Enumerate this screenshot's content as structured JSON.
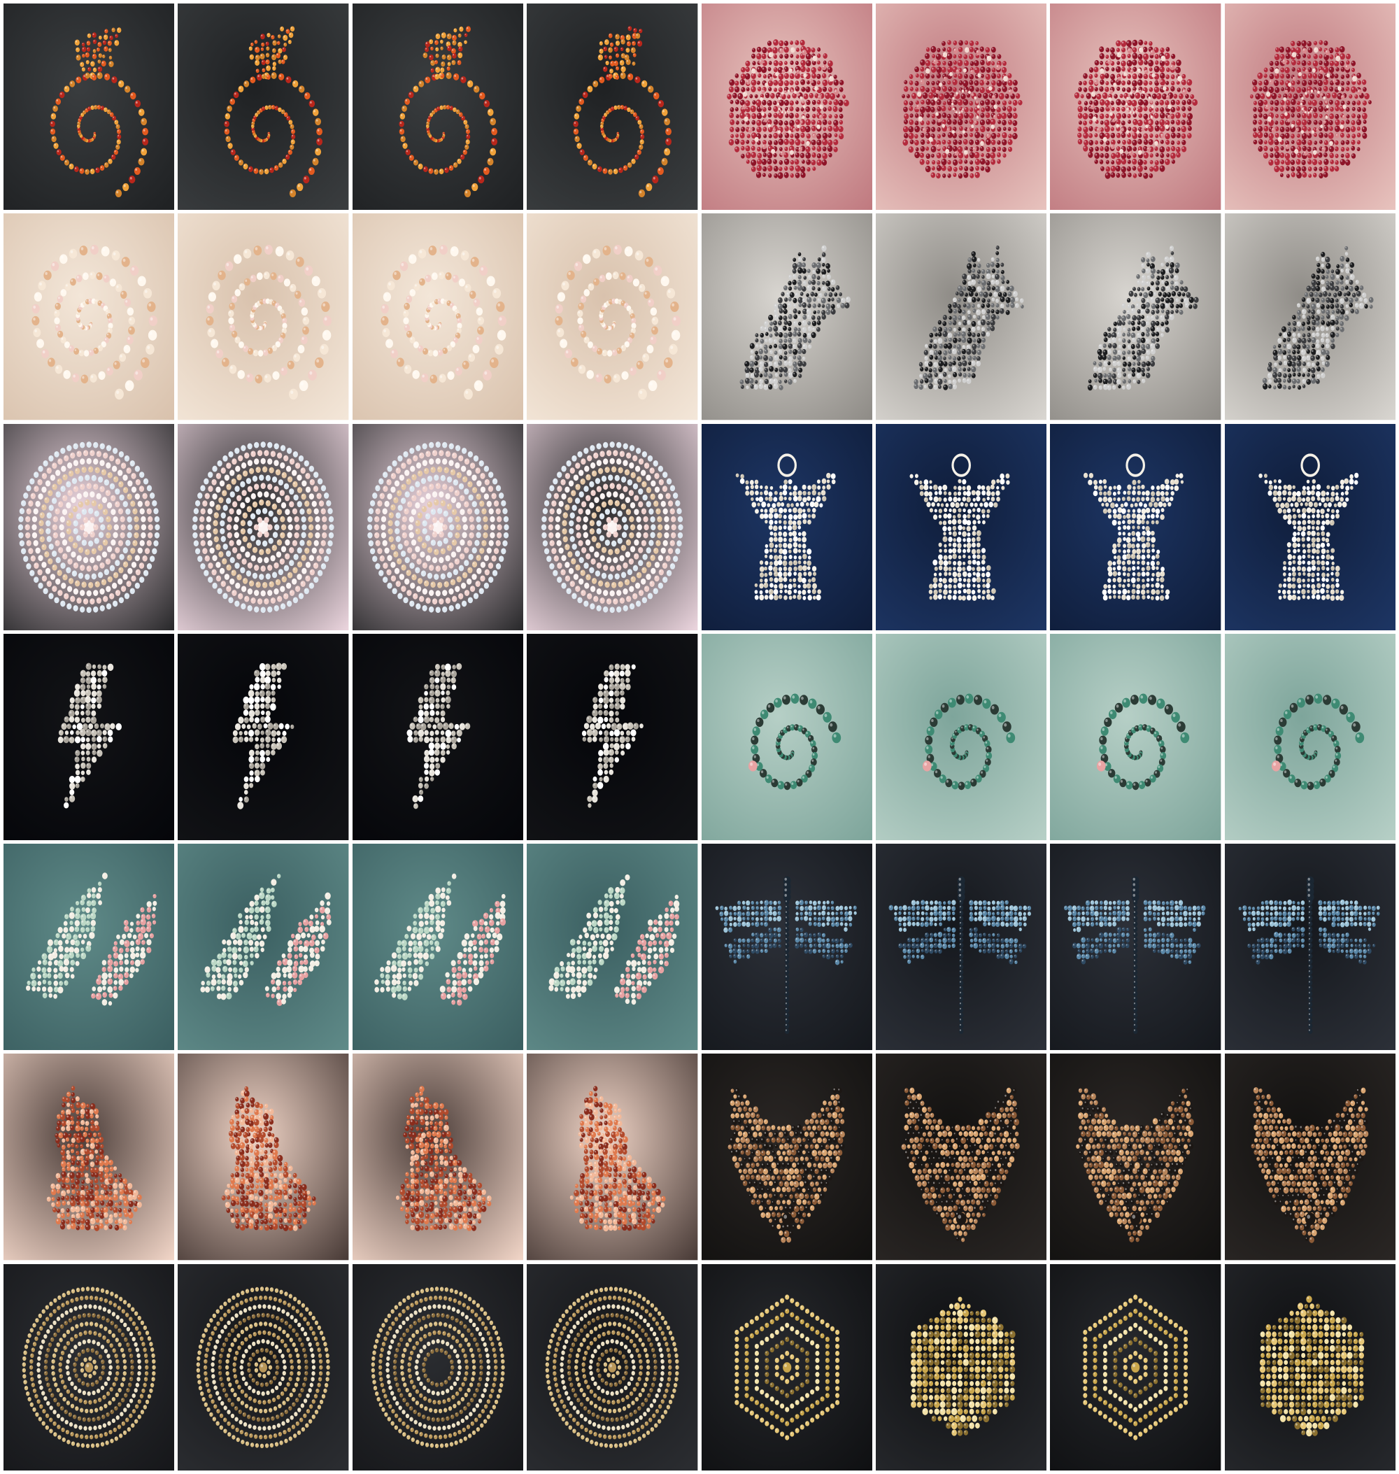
{
  "grid": {
    "columns": 8,
    "rows": 7
  },
  "groups": [
    {
      "subject": "phoenix",
      "bg": [
        "#3a3d3f",
        "#1f2123"
      ],
      "beads": [
        "#e35a1f",
        "#b8261b",
        "#f0a23a",
        "#d4832a"
      ],
      "tiles": 4
    },
    {
      "subject": "rose",
      "bg": [
        "#e7c2bd",
        "#c07a80"
      ],
      "beads": [
        "#8e1428",
        "#b32a3c",
        "#d88a8e",
        "#f2d7cf"
      ],
      "tiles": 4
    },
    {
      "subject": "nautilus",
      "bg": [
        "#f3e6d8",
        "#d9c2ad"
      ],
      "beads": [
        "#f6e7d6",
        "#e3b38b",
        "#f1cfc7",
        "#fff8ef"
      ],
      "tiles": 4
    },
    {
      "subject": "wolf-silhouette",
      "bg": [
        "#d8d5d0",
        "#8f8c87"
      ],
      "beads": [
        "#1c1d1f",
        "#3b3c3f",
        "#6b6d70",
        "#d0d0d0"
      ],
      "tiles": 4
    },
    {
      "subject": "mandala-flower",
      "bg": [
        "#e9d3dc",
        "#2a2a2c"
      ],
      "beads": [
        "#fbf3f2",
        "#f0d2ce",
        "#dfe8f1",
        "#e6c9a8"
      ],
      "tiles": 4
    },
    {
      "subject": "angel",
      "bg": [
        "#1d3563",
        "#0f1d3a"
      ],
      "beads": [
        "#f5f1e8",
        "#e7dfcf",
        "#ffffff",
        "#cfc6b4"
      ],
      "tiles": 4
    },
    {
      "subject": "lightning-bolt",
      "bg": [
        "#121316",
        "#05060a"
      ],
      "beads": [
        "#e8e4dc",
        "#c8c3b9",
        "#ffffff",
        "#a9a49b"
      ],
      "tiles": 4
    },
    {
      "subject": "curl-creature",
      "bg": [
        "#b6cfc6",
        "#7ea59b"
      ],
      "beads": [
        "#2b3b35",
        "#3e8a73",
        "#f3eadf",
        "#e8a3a3"
      ],
      "tiles": 4
    },
    {
      "subject": "wings",
      "bg": [
        "#5f8a88",
        "#3b5f61"
      ],
      "beads": [
        "#bcd8c6",
        "#f3eee4",
        "#e7a2a2",
        "#d9c9a8"
      ],
      "tiles": 4
    },
    {
      "subject": "dragonfly",
      "bg": [
        "#2c3038",
        "#15181d"
      ],
      "beads": [
        "#5b88a8",
        "#2f4a63",
        "#9cc3d8",
        "#1b2733"
      ],
      "tiles": 4
    },
    {
      "subject": "fox-sitting",
      "bg": [
        "#4a3c38",
        "#f0d4c6"
      ],
      "beads": [
        "#b24a2c",
        "#8a2c1c",
        "#e07a4e",
        "#f2b99a"
      ],
      "tiles": 4
    },
    {
      "subject": "wolf-head",
      "bg": [
        "#2a2624",
        "#121110"
      ],
      "beads": [
        "#b8855a",
        "#8c5b37",
        "#d9a571",
        "#1c1714"
      ],
      "tiles": 4
    },
    {
      "subject": "dot-circle",
      "bg": [
        "#2b2d31",
        "#16171a"
      ],
      "beads": [
        "#b9975a",
        "#d8bd82",
        "#8d6f3e",
        "#ece0c2"
      ],
      "tiles": 4
    },
    {
      "subject": "hexagon",
      "bg": [
        "#26282c",
        "#0f1012"
      ],
      "beads": [
        "#c9a64c",
        "#e6c777",
        "#8b7030",
        "#f3e2a8"
      ],
      "tiles": 4
    }
  ]
}
